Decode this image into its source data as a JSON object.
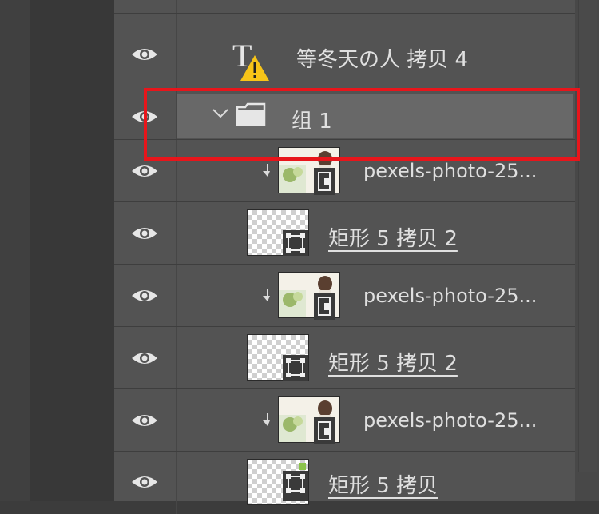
{
  "layers": [
    {
      "name": "等冬天の人 拷贝 4",
      "kind": "text",
      "warning": true
    },
    {
      "name": "组 1",
      "kind": "group",
      "expanded": true,
      "selected": true
    },
    {
      "name": "pexels-photo-25...",
      "kind": "smart-object",
      "clipped": true
    },
    {
      "name": "矩形 5 拷贝 2",
      "kind": "shape"
    },
    {
      "name": "pexels-photo-25...",
      "kind": "smart-object",
      "clipped": true
    },
    {
      "name": "矩形 5 拷贝 2",
      "kind": "shape"
    },
    {
      "name": "pexels-photo-25...",
      "kind": "smart-object",
      "clipped": true
    },
    {
      "name": "矩形 5 拷贝",
      "kind": "shape"
    }
  ],
  "colors": {
    "panel": "#535353",
    "selected_row": "#686868",
    "highlight_box": "#e8151b",
    "warning": "#f7c418"
  }
}
